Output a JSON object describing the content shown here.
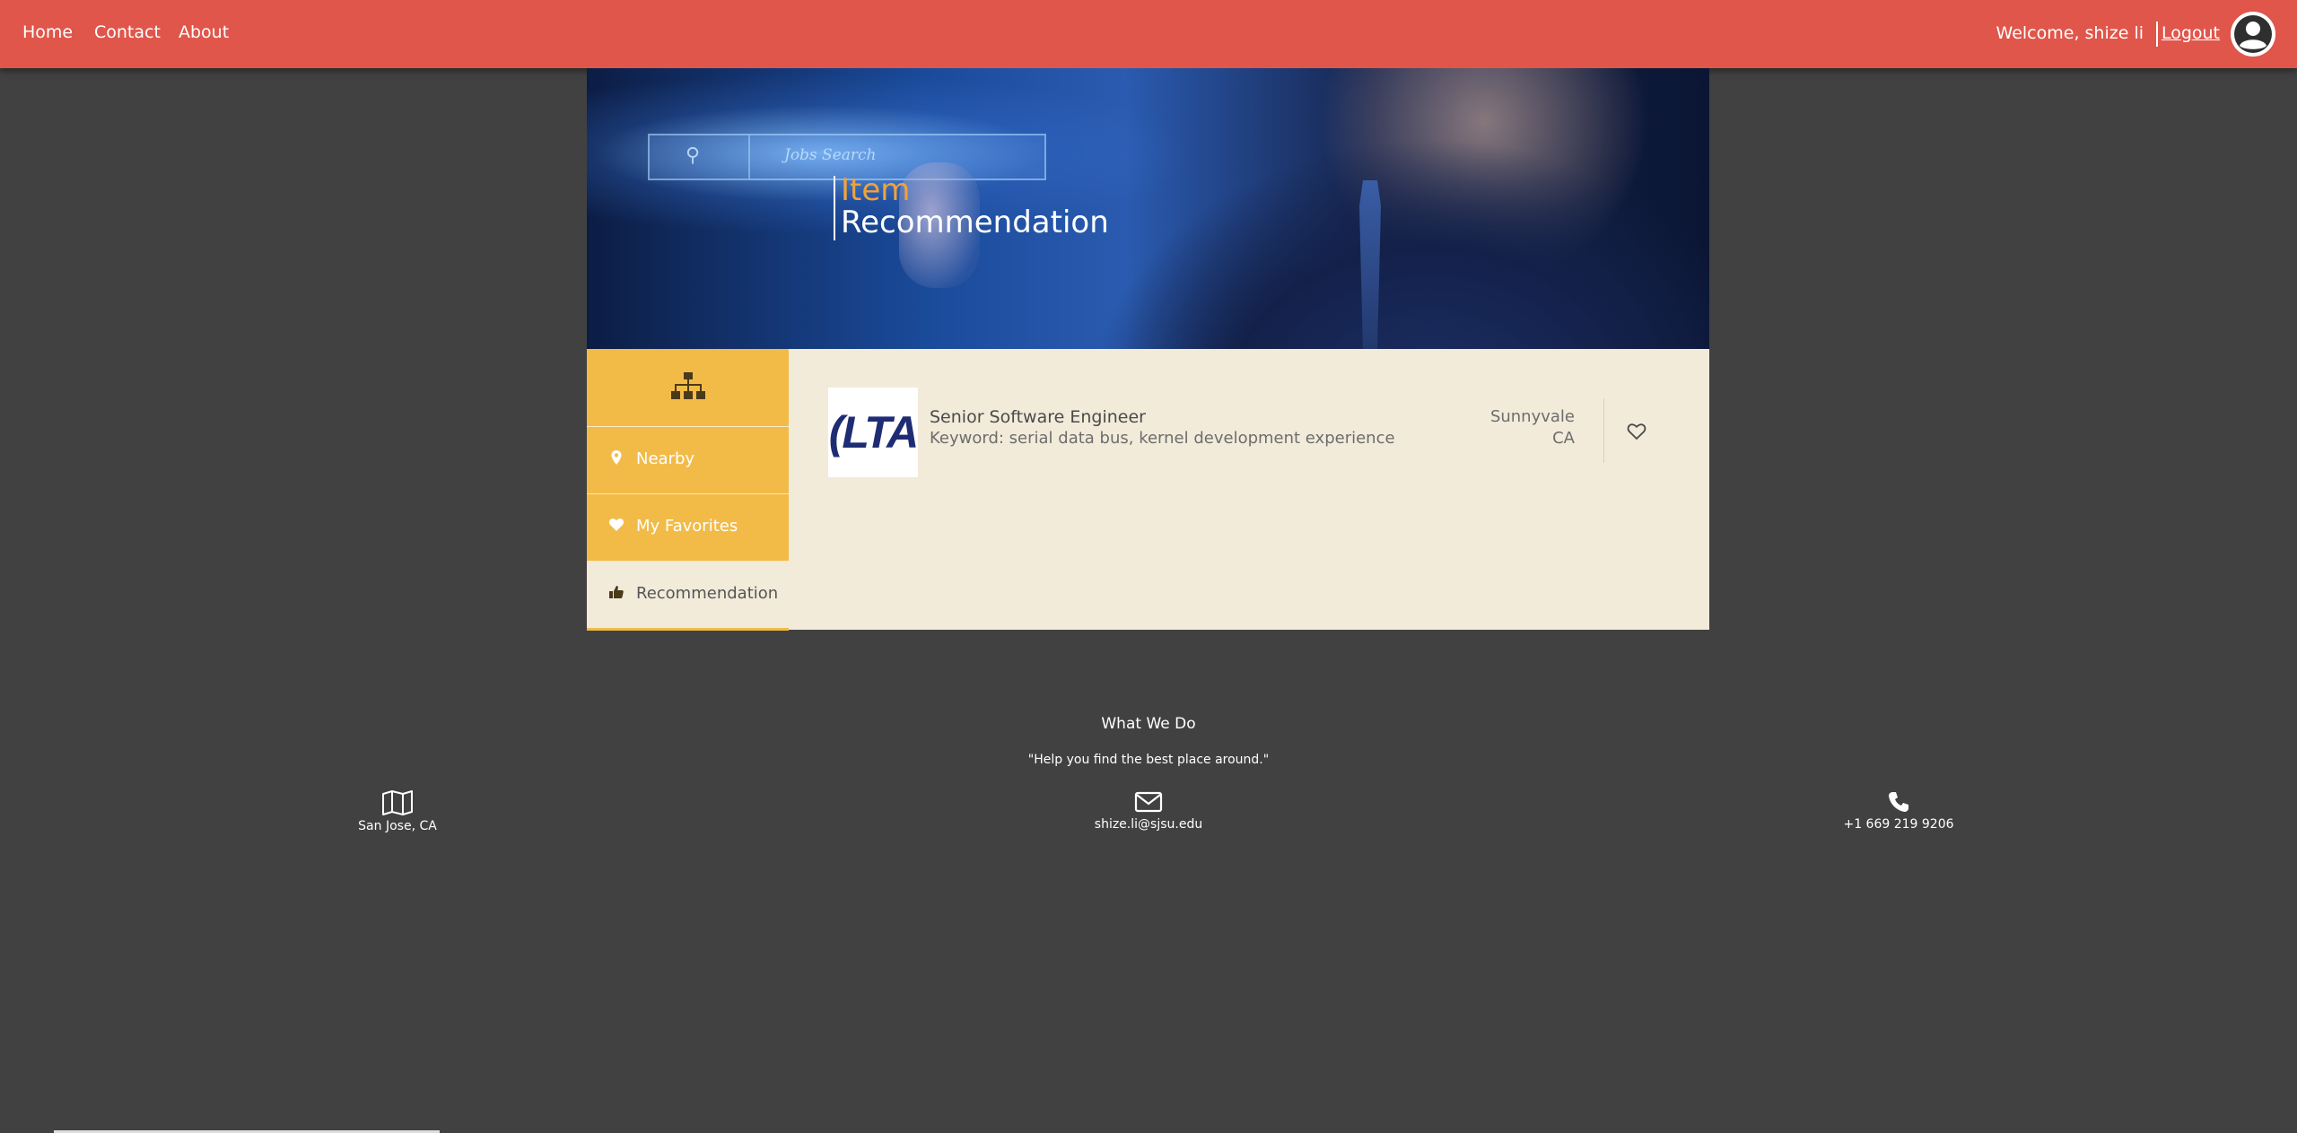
{
  "nav": {
    "links": [
      "Home",
      "Contact",
      "About"
    ],
    "welcome": "Welcome, shize li",
    "logout": "Logout",
    "avatar_icon": "user-circle-icon"
  },
  "hero": {
    "search_text": "Jobs Search",
    "title_line1": "Item",
    "title_line2": "Recommendation",
    "accent_color": "#f0a23c"
  },
  "sidebar": {
    "head_icon": "sitemap-icon",
    "items": [
      {
        "label": "Nearby",
        "icon": "map-marker-icon",
        "active": false
      },
      {
        "label": "My Favorites",
        "icon": "heart-icon",
        "active": false
      },
      {
        "label": "Recommendation",
        "icon": "thumbs-up-icon",
        "active": true
      }
    ],
    "color": "#f2bb48"
  },
  "items": [
    {
      "logo_text": "(LTA",
      "title": "Senior Software Engineer",
      "keyword": "Keyword: serial data bus, kernel development experience",
      "city": "Sunnyvale",
      "state": "CA",
      "favorite": false
    }
  ],
  "footer": {
    "title": "What We Do",
    "quote": "\"Help you find the best place around.\"",
    "location": "San Jose, CA",
    "email": "shize.li@sjsu.edu",
    "phone": "+1 669 219 9206"
  },
  "colors": {
    "nav_bg": "#e0564b",
    "page_bg": "#414141",
    "content_bg": "#f2ebda"
  }
}
